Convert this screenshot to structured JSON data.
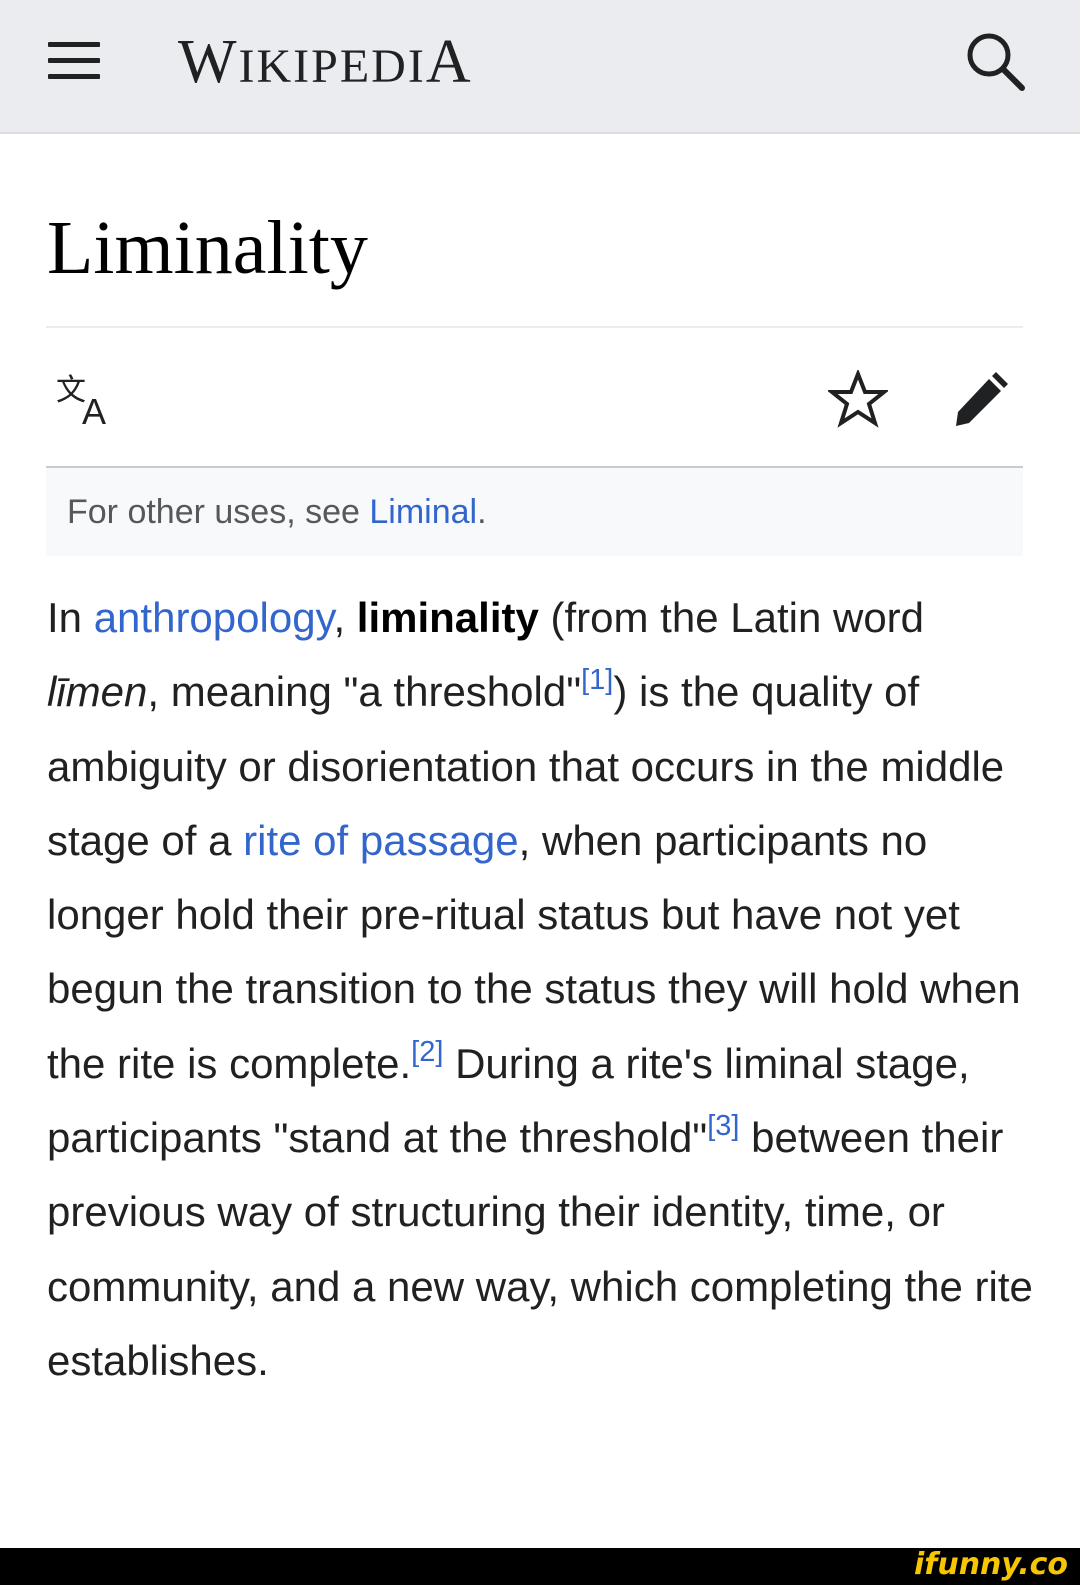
{
  "header": {
    "wordmark": {
      "cap1": "W",
      "part1": "IKIPEDI",
      "cap2": "A"
    },
    "menu_icon": "hamburger-menu-icon",
    "search_icon": "search-icon"
  },
  "page": {
    "title": "Liminality",
    "actions": {
      "language_icon": "language-icon",
      "watch_icon": "star-icon",
      "edit_icon": "pencil-icon"
    }
  },
  "hatnote": {
    "prefix": "For other uses, see ",
    "link": "Liminal",
    "suffix": "."
  },
  "lead": {
    "t1": "In ",
    "link_anthropology": "anthropology",
    "t2": ", ",
    "bold_term": "liminality",
    "t3": " (from the Latin word ",
    "latin_word": "līmen",
    "t4": ", meaning \"a threshold\"",
    "ref1": "[1]",
    "t5": ") is the quality of ambiguity or disorientation that occurs in the middle stage of a ",
    "link_rite": "rite of passage",
    "t6": ", when participants no longer hold their pre-ritual status but have not yet begun the transition to the status they will hold when the rite is complete.",
    "ref2": "[2]",
    "t7": " During a rite's liminal stage, participants \"stand at the threshold\"",
    "ref3": "[3]",
    "t8": " between their previous way of structuring their identity, time, or community, and a new way, which completing the rite establishes."
  },
  "watermark": "ifunny.co",
  "colors": {
    "link": "#3366cc",
    "header_bg": "#eaecf0",
    "hatnote_bg": "#f8f9fa",
    "text": "#202122"
  }
}
